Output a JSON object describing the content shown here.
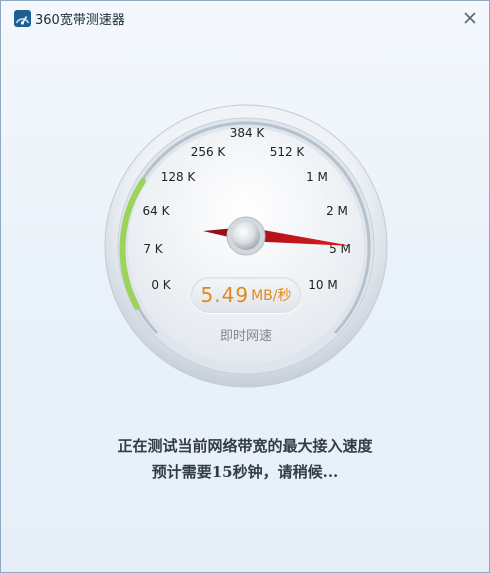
{
  "window": {
    "title": "360宽带测速器"
  },
  "gauge": {
    "scale_labels": [
      "0 K",
      "7 K",
      "64 K",
      "128 K",
      "256 K",
      "384 K",
      "512 K",
      "1 M",
      "2 M",
      "5 M",
      "10 M"
    ],
    "needle_label": "5 M",
    "current_value": "5.49",
    "current_unit": "MB/秒",
    "caption": "即时网速"
  },
  "status": {
    "line1": "正在测试当前网络带宽的最大接入速度",
    "line2": "预计需要15秒钟，请稍候..."
  },
  "colors": {
    "needle": "#c8141c",
    "progress": "#9bd35c",
    "value": "#e08a1c"
  }
}
